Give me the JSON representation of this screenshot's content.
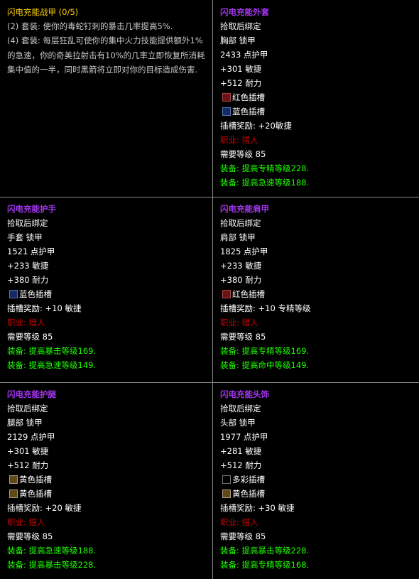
{
  "set_panel": {
    "title": "闪电充能战甲 (0/5)",
    "bonus2": "(2) 套装: 使你的毒蛇钉刺的暴击几率提高5%.",
    "bonus4": "(4) 套装: 每层狂乱可使你的集中火力技能提供额外1%的急速，你的奇美拉射击有10%的几率立即恢复所消耗集中值的一半，同时黑箭将立即对你的目标造成伤害."
  },
  "items": [
    {
      "name": "闪电充能外套",
      "bind": "拾取后绑定",
      "slot": "胸部 锁甲",
      "armor": "2433 点护甲",
      "agility": "+301 敏捷",
      "stamina": "+512 耐力",
      "sockets": [
        {
          "color": "red",
          "icon": "red-socket-icon",
          "label": "红色插槽"
        },
        {
          "color": "blue",
          "icon": "blue-socket-icon",
          "label": "蓝色插槽"
        }
      ],
      "socket_bonus": "插槽奖励: +20敏捷",
      "class_req": "职业: 猎人",
      "level_req": "需要等级 85",
      "equip": [
        "装备: 提高专精等级228.",
        "装备: 提高急速等级188."
      ]
    },
    {
      "name": "闪电充能护手",
      "bind": "拾取后绑定",
      "slot": "手套 锁甲",
      "armor": "1521 点护甲",
      "agility": "+233 敏捷",
      "stamina": "+380 耐力",
      "sockets": [
        {
          "color": "blue",
          "icon": "blue-socket-icon",
          "label": "蓝色插槽"
        }
      ],
      "socket_bonus": "插槽奖励: +10 敏捷",
      "class_req": "职业: 猎人",
      "level_req": "需要等级 85",
      "equip": [
        "装备: 提高暴击等级169.",
        "装备: 提高急速等级149."
      ]
    },
    {
      "name": "闪电充能肩甲",
      "bind": "拾取后绑定",
      "slot": "肩部 锁甲",
      "armor": "1825 点护甲",
      "agility": "+233 敏捷",
      "stamina": "+380 耐力",
      "sockets": [
        {
          "color": "red",
          "icon": "red-socket-icon",
          "label": "红色插槽"
        }
      ],
      "socket_bonus": "插槽奖励: +10 专精等级",
      "class_req": "职业: 猎人",
      "level_req": "需要等级 85",
      "equip": [
        "装备: 提高专精等级169.",
        "装备: 提高命中等级149."
      ]
    },
    {
      "name": "闪电充能护腿",
      "bind": "拾取后绑定",
      "slot": "腿部 锁甲",
      "armor": "2129 点护甲",
      "agility": "+301 敏捷",
      "stamina": "+512 耐力",
      "sockets": [
        {
          "color": "yellow",
          "icon": "yellow-socket-icon",
          "label": "黄色插槽"
        },
        {
          "color": "yellow",
          "icon": "yellow-socket-icon",
          "label": "黄色插槽"
        }
      ],
      "socket_bonus": "插槽奖励: +20 敏捷",
      "class_req": "职业: 猎人",
      "level_req": "需要等级 85",
      "equip": [
        "装备: 提高急速等级188.",
        "装备: 提高暴击等级228."
      ]
    },
    {
      "name": "闪电充能头饰",
      "bind": "拾取后绑定",
      "slot": "头部 锁甲",
      "armor": "1977 点护甲",
      "agility": "+281 敏捷",
      "stamina": "+512 耐力",
      "sockets": [
        {
          "color": "prismatic",
          "icon": "prismatic-socket-icon",
          "label": "多彩插槽"
        },
        {
          "color": "yellow",
          "icon": "yellow-socket-icon",
          "label": "黄色插槽"
        }
      ],
      "socket_bonus": "插槽奖励: +30 敏捷",
      "class_req": "职业: 猎人",
      "level_req": "需要等级 85",
      "equip": [
        "装备: 提高暴击等级228.",
        "装备: 提高专精等级168."
      ]
    }
  ]
}
